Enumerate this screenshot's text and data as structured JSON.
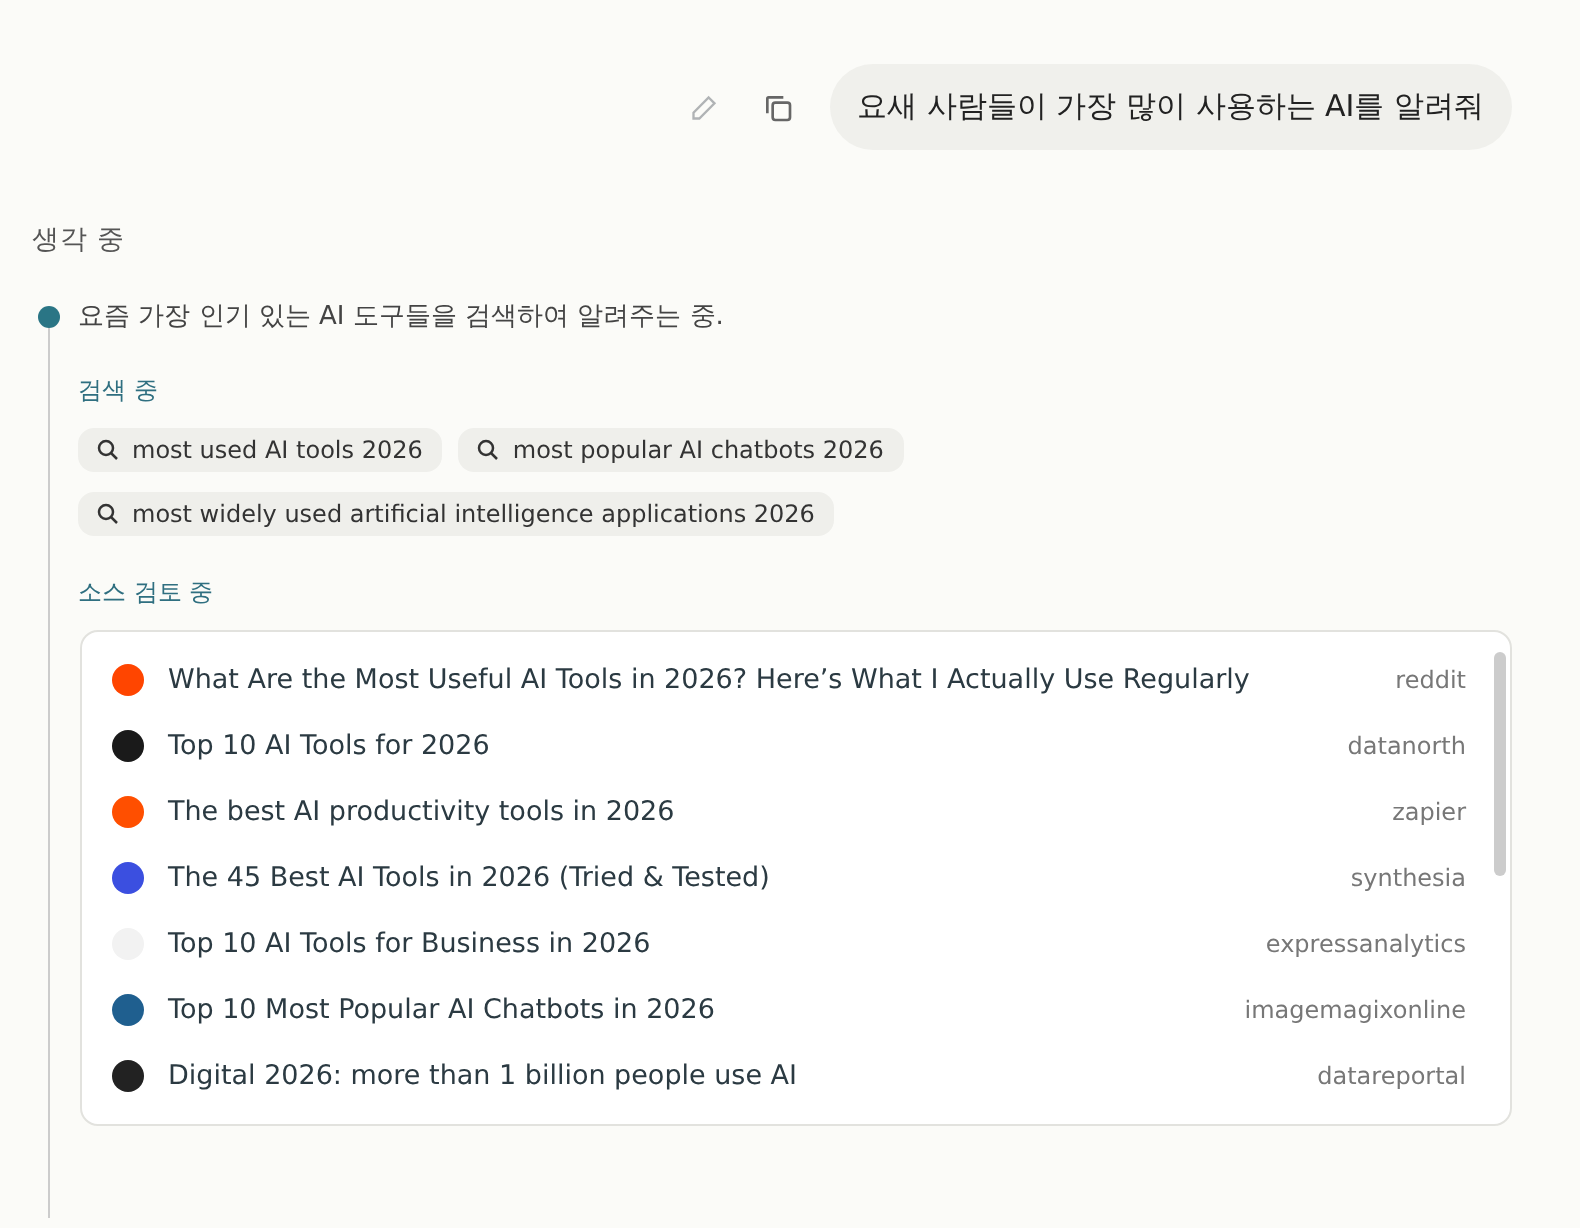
{
  "user_message": {
    "text": "요새 사람들이 가장 많이 사용하는 AI를 알려줘"
  },
  "thinking": {
    "title": "생각 중",
    "step": "요즘 가장 인기 있는 AI 도구들을 검색하여 알려주는 중.",
    "search_label": "검색 중",
    "queries": [
      "most used AI tools 2026",
      "most popular AI chatbots 2026",
      "most widely used artificial intelligence applications 2026"
    ],
    "sources_label": "소스 검토 중",
    "sources": [
      {
        "title": "What Are the Most Useful AI Tools in 2026? Here’s What I Actually Use Regularly",
        "site": "reddit",
        "color": "#ff4500"
      },
      {
        "title": "Top 10 AI Tools for 2026",
        "site": "datanorth",
        "color": "#1a1a1a"
      },
      {
        "title": "The best AI productivity tools in 2026",
        "site": "zapier",
        "color": "#ff4f00"
      },
      {
        "title": "The 45 Best AI Tools in 2026 (Tried & Tested)",
        "site": "synthesia",
        "color": "#3b4fe0"
      },
      {
        "title": "Top 10 AI Tools for Business in 2026",
        "site": "expressanalytics",
        "color": "#f2f2f2"
      },
      {
        "title": "Top 10 Most Popular AI Chatbots in 2026",
        "site": "imagemagixonline",
        "color": "#1f5f8f"
      },
      {
        "title": "Digital 2026: more than 1 billion people use AI",
        "site": "datareportal",
        "color": "#222222"
      }
    ]
  }
}
